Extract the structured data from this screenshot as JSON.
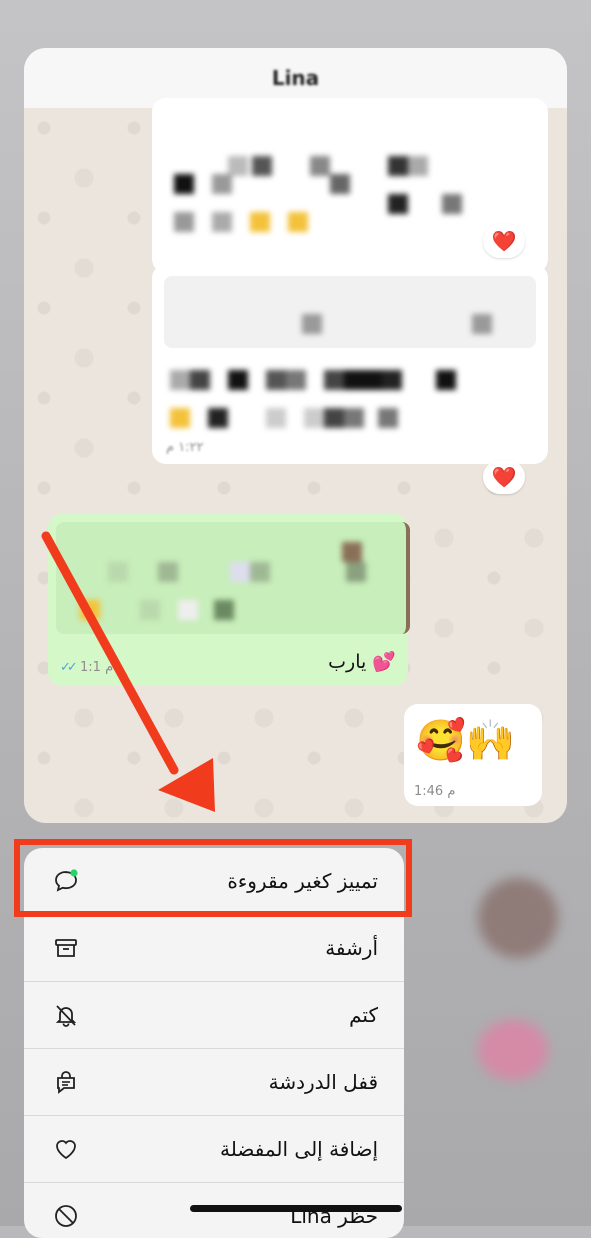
{
  "chat": {
    "contact_name": "Lina",
    "messages": [
      {
        "reaction": "❤️"
      },
      {
        "time": "١:٢٢ م",
        "reaction": "❤️"
      },
      {
        "text": "يارب 💕",
        "time": "1:1 م"
      },
      {
        "text": "🥰🙌",
        "time": "1:46 م"
      }
    ]
  },
  "menu": {
    "items": [
      {
        "label": "تمييز كغير مقروءة",
        "icon": "unread-bubble-icon"
      },
      {
        "label": "أرشفة",
        "icon": "archive-icon"
      },
      {
        "label": "كتم",
        "icon": "mute-bell-icon"
      },
      {
        "label": "قفل الدردشة",
        "icon": "lock-chat-icon"
      },
      {
        "label": "إضافة إلى المفضلة",
        "icon": "heart-icon"
      },
      {
        "label": "حظر Lina",
        "icon": "block-icon"
      }
    ]
  },
  "colors": {
    "highlight": "#f03b1c",
    "accent_dot": "#25d366",
    "outgoing_bubble": "#d5f8c9"
  }
}
